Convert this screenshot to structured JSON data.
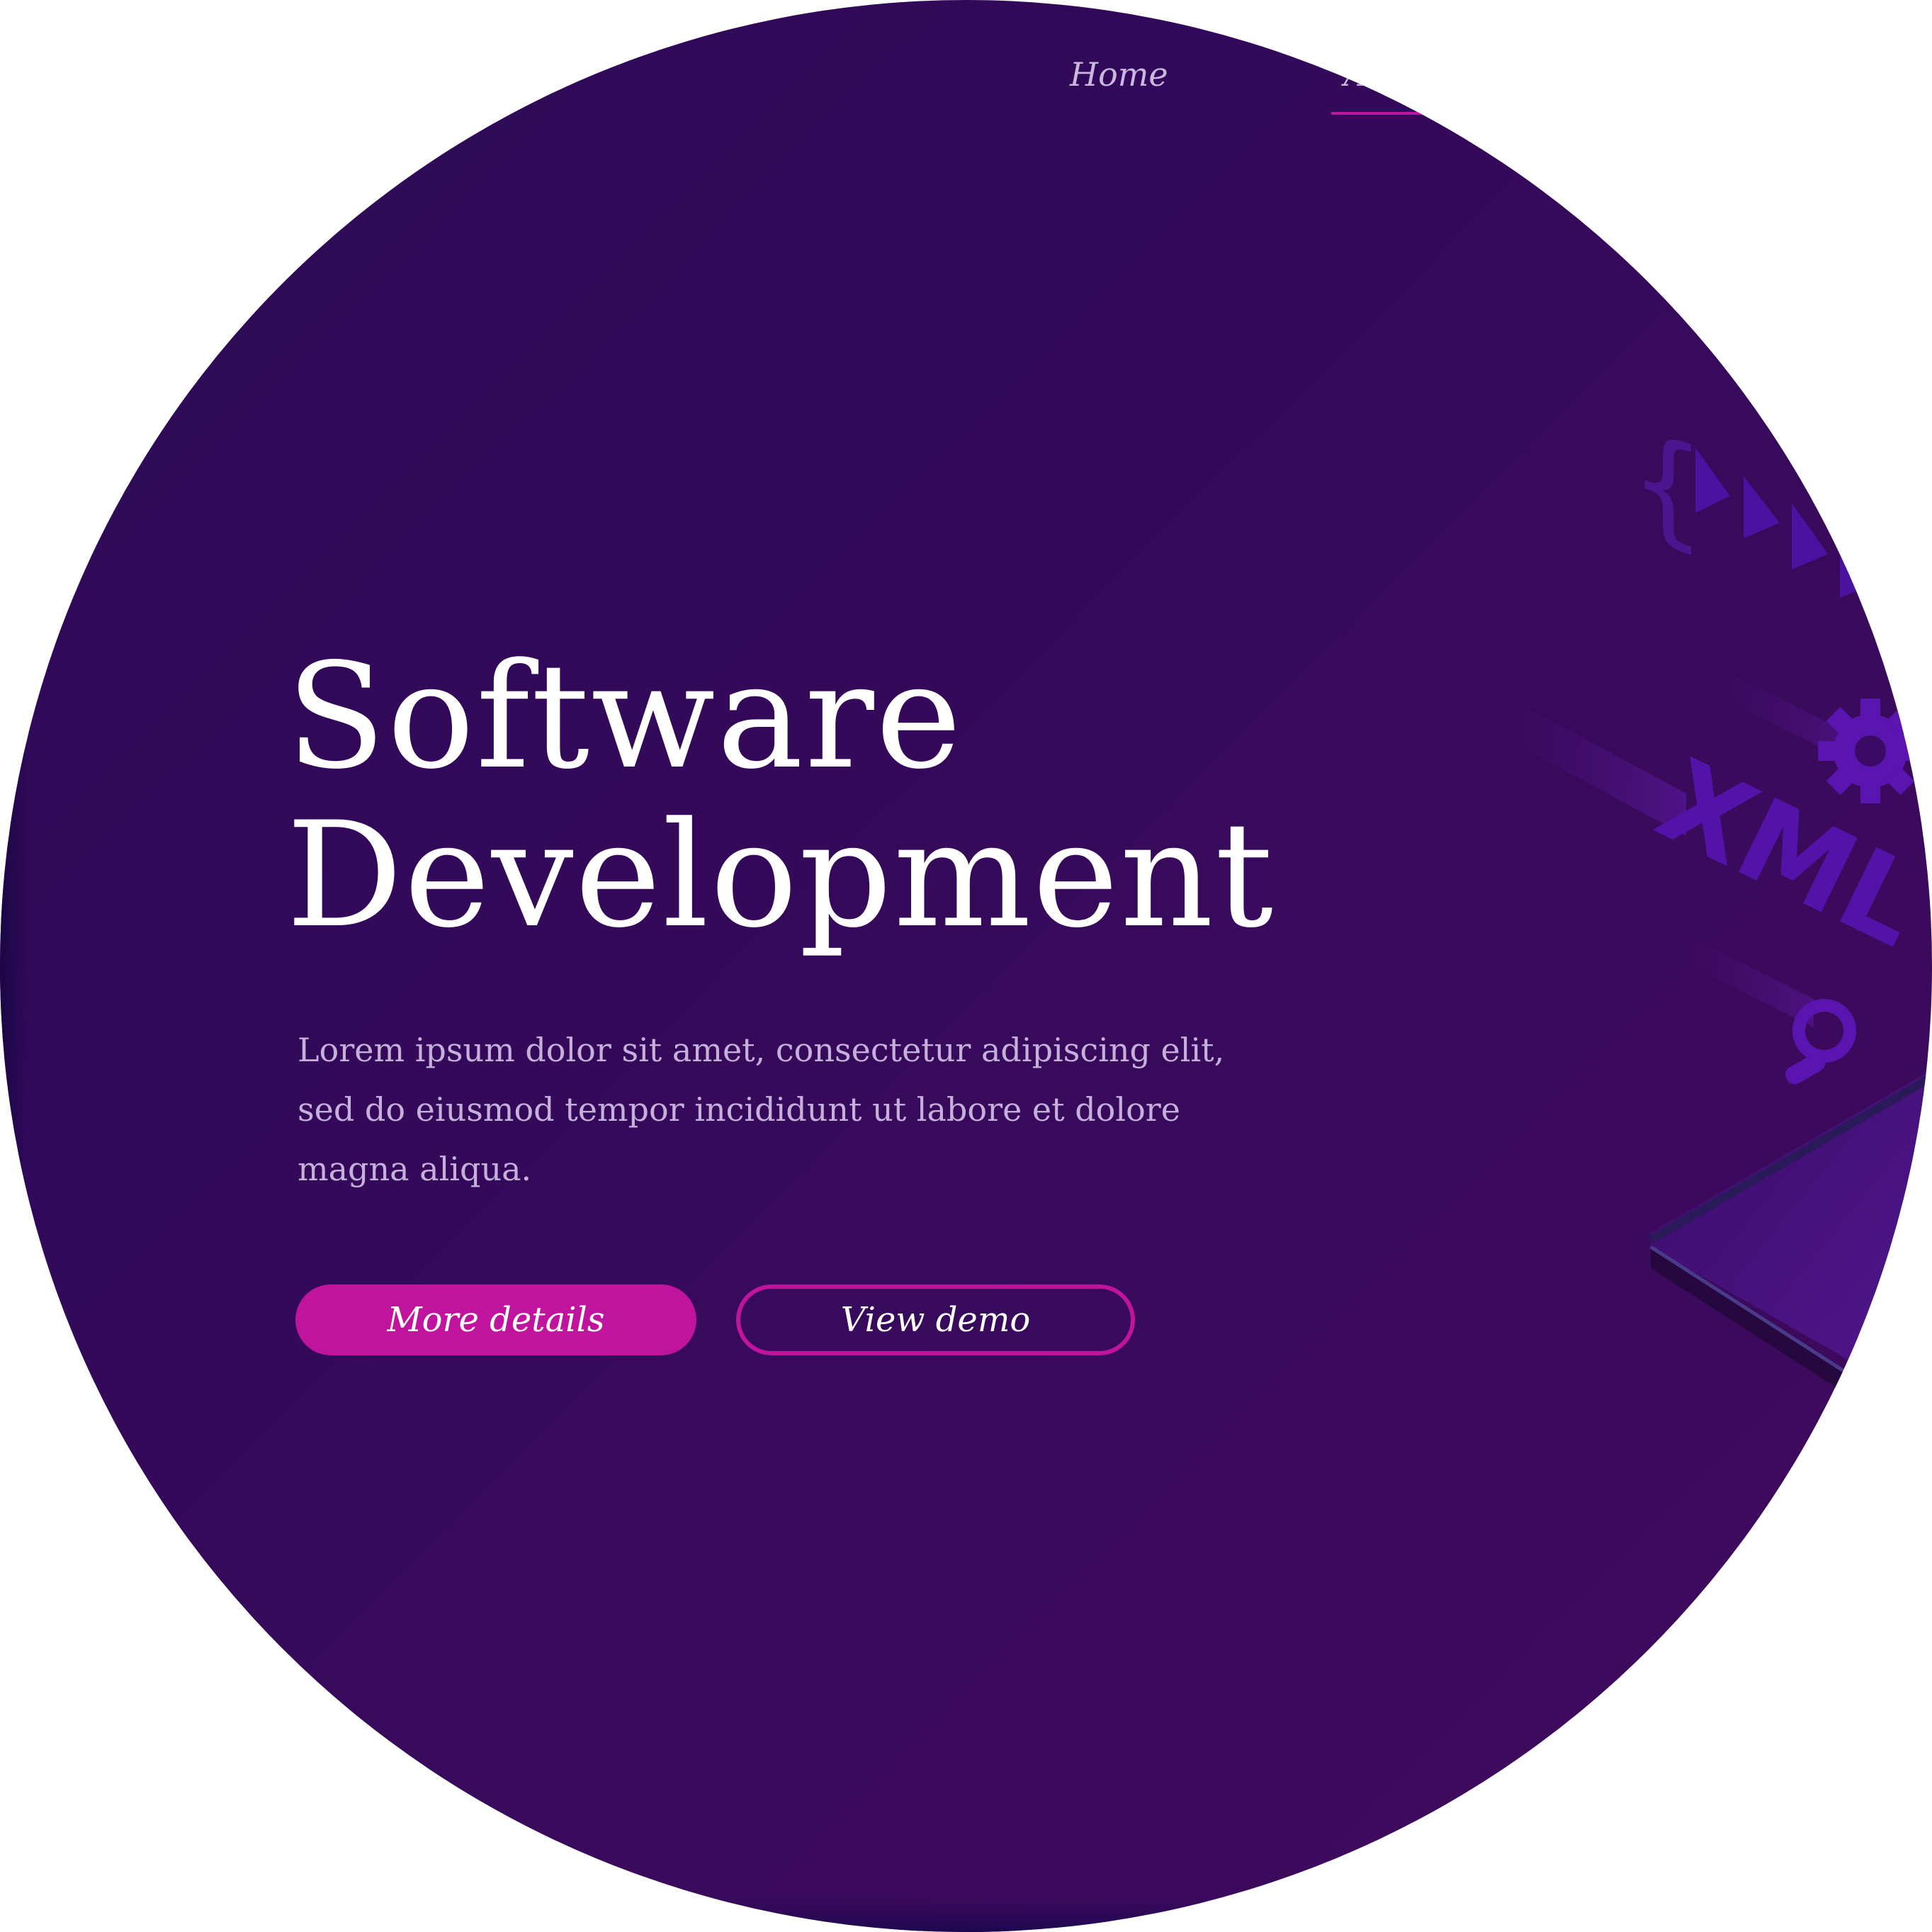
{
  "nav": {
    "items": [
      {
        "label": "Home"
      },
      {
        "label": "About"
      }
    ],
    "active_accent": "#c0159e"
  },
  "hero": {
    "title_line1": "Software",
    "title_line2": "Development",
    "description": "Lorem ipsum dolor sit amet, consectetur adipiscing elit, sed do eiusmod tempor incididunt ut labore et dolore magna aliqua."
  },
  "buttons": {
    "primary_label": "More details",
    "secondary_label": "View demo"
  },
  "illustration": {
    "badge_text": "XML",
    "icons": [
      "curly-brace-icon",
      "play-arrow-icon",
      "gear-icon",
      "search-icon",
      "device-screen"
    ]
  },
  "colors": {
    "background": "#33095a",
    "accent": "#c0149e",
    "text": "#ffffff",
    "muted_text": "#c5afdb"
  }
}
